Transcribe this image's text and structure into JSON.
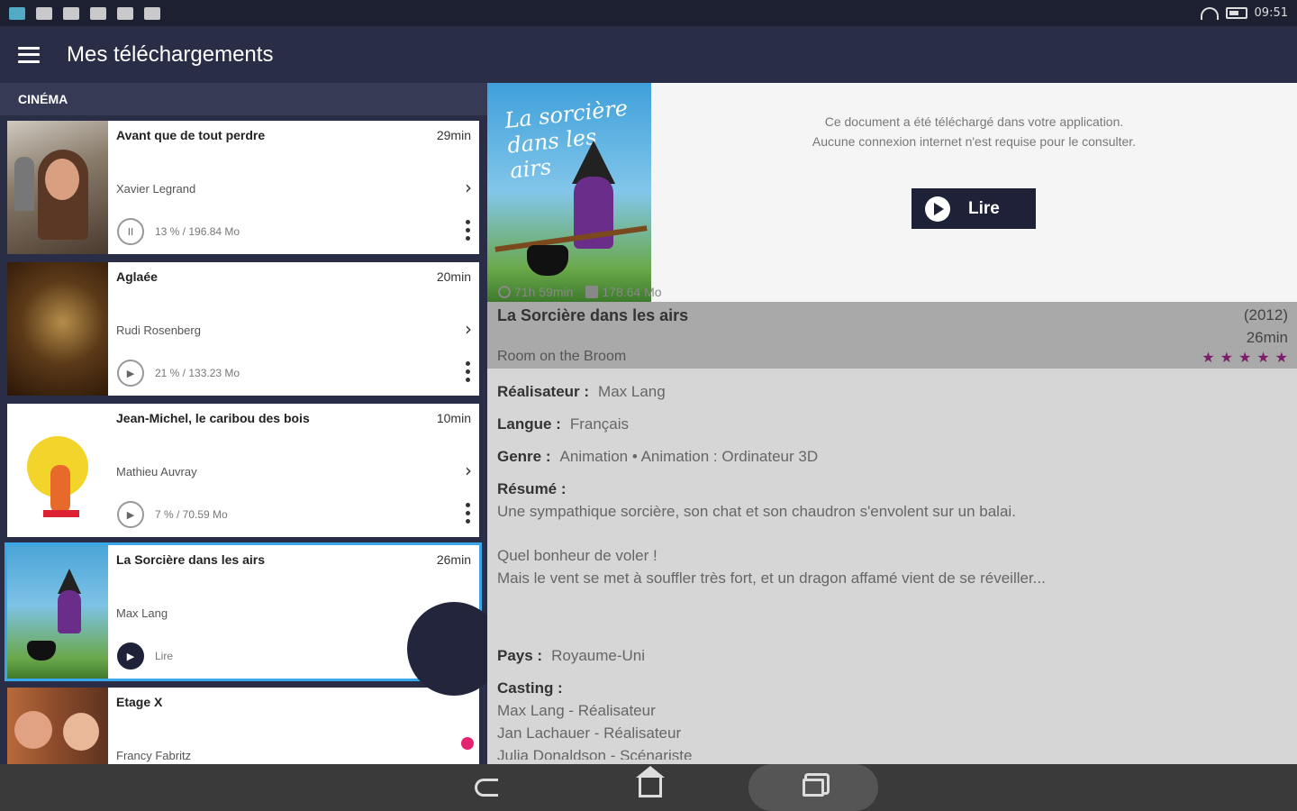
{
  "status_bar": {
    "time": "09:51",
    "icons": [
      "app-icon",
      "cloud-icon",
      "keyboard-icon",
      "sync-icon",
      "photo-icon",
      "play-store-icon"
    ]
  },
  "app_bar": {
    "title": "Mes téléchargements"
  },
  "section": {
    "label": "CINÉMA"
  },
  "downloads": [
    {
      "title": "Avant que de tout perdre",
      "duration": "29min",
      "director": "Xavier Legrand",
      "status": "13 % / 196.84 Mo",
      "action_icon": "pause-icon"
    },
    {
      "title": "Aglaée",
      "duration": "20min",
      "director": "Rudi Rosenberg",
      "status": "21 % / 133.23 Mo",
      "action_icon": "play-icon"
    },
    {
      "title": "Jean-Michel, le caribou des bois",
      "duration": "10min",
      "director": "Mathieu Auvray",
      "status": "7 % / 70.59 Mo",
      "action_icon": "play-icon"
    },
    {
      "title": "La Sorcière dans les airs",
      "duration": "26min",
      "director": "Max Lang",
      "status": "Lire",
      "action_icon": "play-icon"
    },
    {
      "title": "Etage X",
      "duration": "",
      "director": "Francy Fabritz",
      "status": "",
      "action_icon": ""
    }
  ],
  "detail": {
    "poster_title": "La sorcière dans les airs",
    "offline_line1": "Ce document a été téléchargé dans votre application.",
    "offline_line2": "Aucune connexion internet n'est requise pour le consulter.",
    "play_label": "Lire",
    "availability": "71h 59min",
    "size": "178.64 Mo",
    "title": "La Sorcière dans les airs",
    "year": "(2012)",
    "duration": "26min",
    "original_title": "Room on the Broom",
    "rating_stars": 5,
    "director_label": "Réalisateur :",
    "director": "Max Lang",
    "language_label": "Langue :",
    "language": "Français",
    "genre_label": "Genre :",
    "genre": "Animation • Animation : Ordinateur 3D",
    "summary_label": "Résumé :",
    "summary_1": "Une sympathique sorcière, son chat et son chaudron s'envolent sur un balai.",
    "summary_2": "Quel bonheur de voler !",
    "summary_3": "Mais le vent se met à souffler très fort, et un dragon affamé vient de se réveiller...",
    "country_label": "Pays :",
    "country": "Royaume-Uni",
    "cast_label": "Casting :",
    "cast": [
      "Max Lang - Réalisateur",
      "Jan Lachauer - Réalisateur",
      "Julia Donaldson - Scénariste"
    ]
  },
  "nav_bar": {
    "buttons": [
      "back-icon",
      "home-icon",
      "recents-icon"
    ]
  }
}
